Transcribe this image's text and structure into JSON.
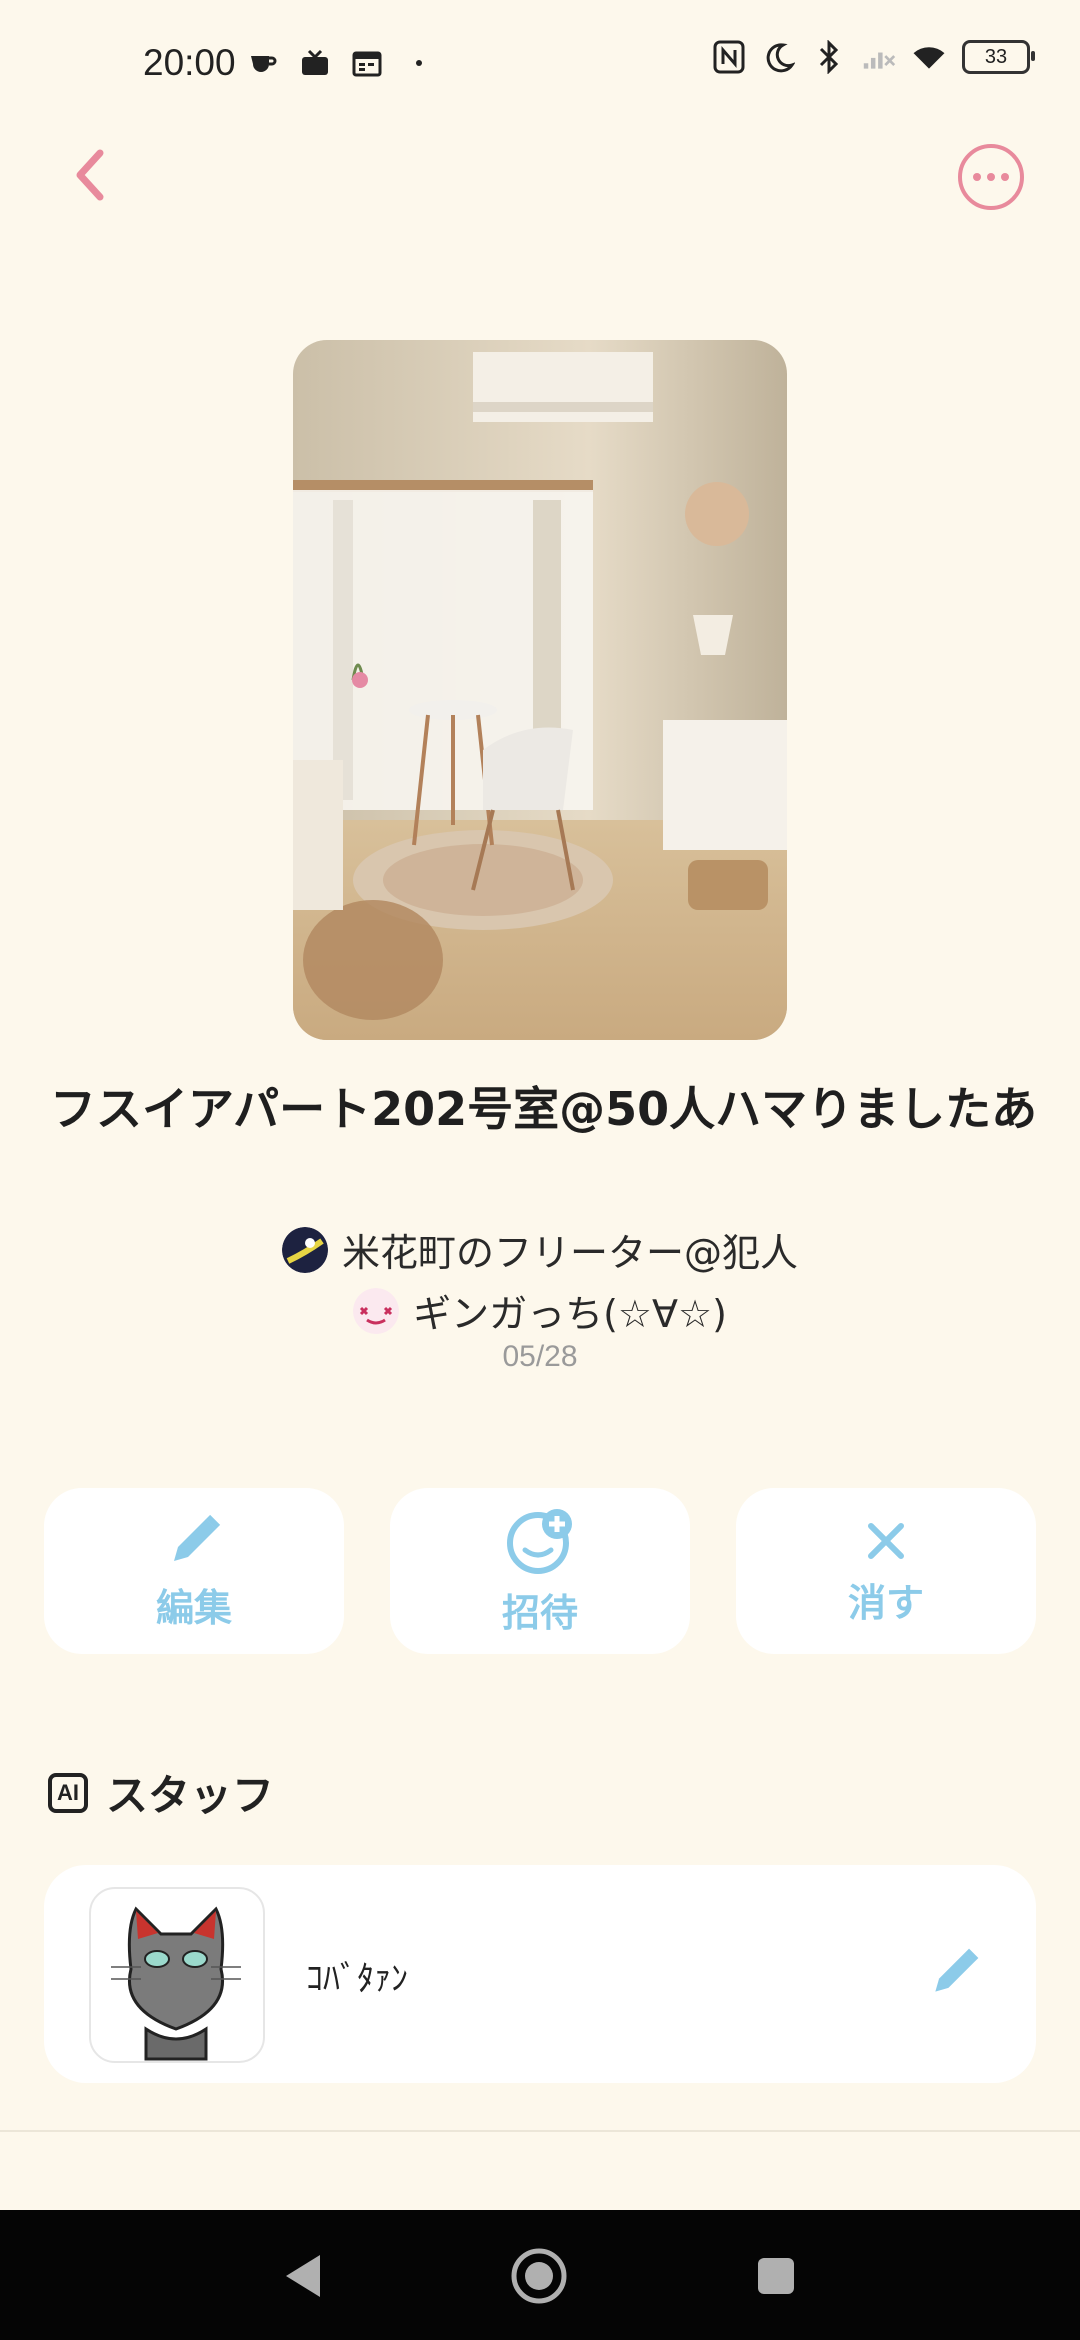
{
  "status_bar": {
    "time": "20:00",
    "battery": "33",
    "left_icons": [
      "coffee-icon",
      "tv-icon",
      "calendar-icon",
      "dot-icon"
    ],
    "right_icons": [
      "nfc-icon",
      "moon-icon",
      "bluetooth-icon",
      "signal-icon",
      "wifi-icon"
    ]
  },
  "header": {
    "back": "back-icon",
    "more": "more-icon"
  },
  "room": {
    "title": "フスイアパート202号室@50人ハマりましたあ",
    "participants": [
      {
        "name": "米花町のフリーター@犯人"
      },
      {
        "name": "ギンガっち(☆∀☆)"
      }
    ],
    "date": "05/28"
  },
  "actions": [
    {
      "label": "編集",
      "icon": "pencil-icon"
    },
    {
      "label": "招待",
      "icon": "invite-icon"
    },
    {
      "label": "消す",
      "icon": "close-icon"
    }
  ],
  "staff_section": {
    "badge": "AI",
    "title": "スタッフ",
    "items": [
      {
        "name": "ｺﾊﾞﾀｧﾝ"
      }
    ]
  },
  "colors": {
    "background": "#fdf8ec",
    "accent_pink": "#e88a9c",
    "accent_blue": "#8ccbe9"
  }
}
